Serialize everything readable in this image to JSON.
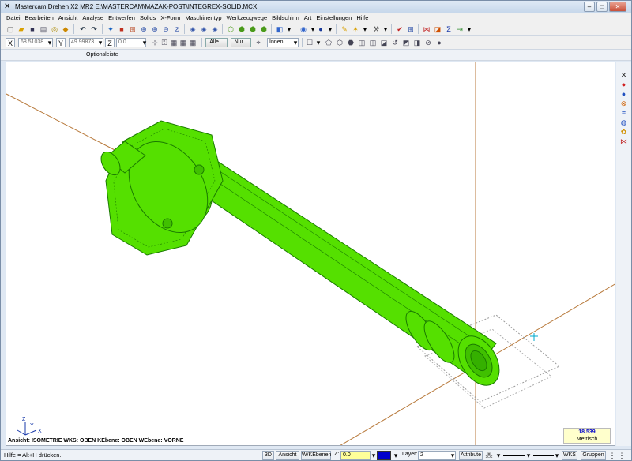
{
  "window": {
    "title": "Mastercam Drehen X2 MR2  E:\\MASTERCAM\\MAZAK-POST\\INTEGREX-SOLID.MCX",
    "buttons": {
      "minimize": "–",
      "maximize": "□",
      "close": "✕"
    }
  },
  "menu": [
    "Datei",
    "Bearbeiten",
    "Ansicht",
    "Analyse",
    "Entwerfen",
    "Solids",
    "X-Form",
    "Maschinentyp",
    "Werkzeugwege",
    "Bildschirm",
    "Art",
    "Einstellungen",
    "Hilfe"
  ],
  "coords": {
    "x_label": "X",
    "x_value": "68.51038",
    "y_label": "Y",
    "y_value": "49.99873",
    "z_label": "Z",
    "z_value": "0.0"
  },
  "selection": {
    "all_button": "Alle...",
    "only_button": "Nur...",
    "mode": "Innen"
  },
  "optionsleiste_label": "Optionsleiste",
  "viewport": {
    "view_info": "Ansicht: ISOMETRIE   WKS: OBEN   KEbene: OBEN   WEbene: VORNE",
    "axis": {
      "x": "X",
      "y": "Y",
      "z": "Z"
    },
    "scale_value": "18.539",
    "scale_unit": "Metrisch",
    "colors": {
      "part": "#55e000",
      "edge": "#1a7a00",
      "axis": "#b87a3c"
    }
  },
  "status": {
    "hint": "Hilfe = Alt+H drücken.",
    "btn_3d": "3D",
    "btn_view": "Ansicht",
    "btn_wkebenen": "W/KEbenen",
    "z_label": "Z:",
    "z_value": "0.0",
    "layer_label": "Layer:",
    "layer_value": "2",
    "attr": "Attribute",
    "wks": "WKS",
    "groups": "Gruppen"
  }
}
